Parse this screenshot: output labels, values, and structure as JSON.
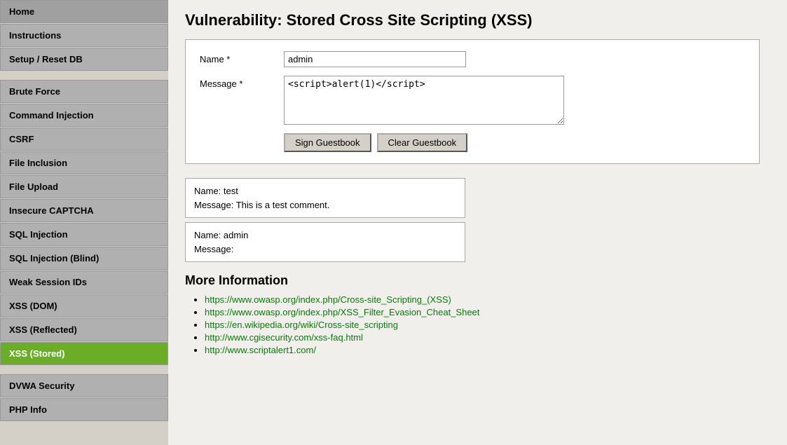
{
  "sidebar": {
    "items_top": [
      {
        "label": "Home",
        "id": "home",
        "active": false
      },
      {
        "label": "Instructions",
        "id": "instructions",
        "active": false
      },
      {
        "label": "Setup / Reset DB",
        "id": "setup-reset-db",
        "active": false
      }
    ],
    "items_mid": [
      {
        "label": "Brute Force",
        "id": "brute-force",
        "active": false
      },
      {
        "label": "Command Injection",
        "id": "command-injection",
        "active": false
      },
      {
        "label": "CSRF",
        "id": "csrf",
        "active": false
      },
      {
        "label": "File Inclusion",
        "id": "file-inclusion",
        "active": false
      },
      {
        "label": "File Upload",
        "id": "file-upload",
        "active": false
      },
      {
        "label": "Insecure CAPTCHA",
        "id": "insecure-captcha",
        "active": false
      },
      {
        "label": "SQL Injection",
        "id": "sql-injection",
        "active": false
      },
      {
        "label": "SQL Injection (Blind)",
        "id": "sql-injection-blind",
        "active": false
      },
      {
        "label": "Weak Session IDs",
        "id": "weak-session-ids",
        "active": false
      },
      {
        "label": "XSS (DOM)",
        "id": "xss-dom",
        "active": false
      },
      {
        "label": "XSS (Reflected)",
        "id": "xss-reflected",
        "active": false
      },
      {
        "label": "XSS (Stored)",
        "id": "xss-stored",
        "active": true
      }
    ],
    "items_bot": [
      {
        "label": "DVWA Security",
        "id": "dvwa-security",
        "active": false
      },
      {
        "label": "PHP Info",
        "id": "php-info",
        "active": false
      }
    ]
  },
  "main": {
    "title": "Vulnerability: Stored Cross Site Scripting (XSS)",
    "form": {
      "name_label": "Name *",
      "name_value": "admin",
      "message_label": "Message *",
      "message_value": "<script>alert(1)</script>",
      "sign_btn": "Sign Guestbook",
      "clear_btn": "Clear Guestbook"
    },
    "comments": [
      {
        "name": "Name: test",
        "message": "Message: This is a test comment."
      },
      {
        "name": "Name: admin",
        "message": "Message:"
      }
    ],
    "more_info_title": "More Information",
    "links": [
      {
        "text": "https://www.owasp.org/index.php/Cross-site_Scripting_(XSS)",
        "href": "#"
      },
      {
        "text": "https://www.owasp.org/index.php/XSS_Filter_Evasion_Cheat_Sheet",
        "href": "#"
      },
      {
        "text": "https://en.wikipedia.org/wiki/Cross-site_scripting",
        "href": "#"
      },
      {
        "text": "http://www.cgisecurity.com/xss-faq.html",
        "href": "#"
      },
      {
        "text": "http://www.scriptalert1.com/",
        "href": "#"
      }
    ]
  }
}
